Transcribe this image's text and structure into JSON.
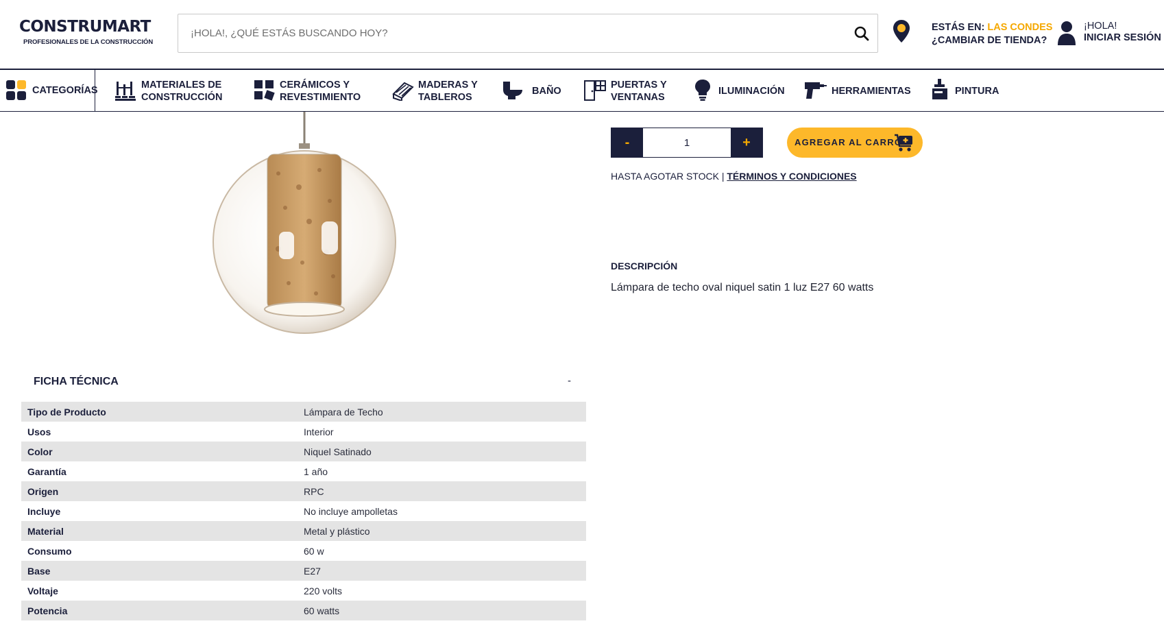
{
  "header": {
    "logo_word": "CONSTRUMART",
    "logo_tagline": "PROFESIONALES DE LA CONSTRUCCIÓN",
    "search_placeholder": "¡HOLA!, ¿QUÉ ESTÁS BUSCANDO HOY?",
    "search_value": "",
    "store_prefix": "ESTÁS EN: ",
    "store_name": "LAS CONDES",
    "change_store": "¿CAMBIAR DE TIENDA?",
    "greeting": "¡HOLA!",
    "login": "INICIAR SESIÓN"
  },
  "nav": {
    "categories": "CATEGORÍAS",
    "items": [
      {
        "line1": "MATERIALES DE",
        "line2": "CONSTRUCCIÓN",
        "icon": "bricks-icon"
      },
      {
        "line1": "CERÁMICOS Y",
        "line2": "REVESTIMIENTO",
        "icon": "tiles-icon"
      },
      {
        "line1": "MADERAS Y",
        "line2": "TABLEROS",
        "icon": "wood-icon"
      },
      {
        "line1": "BAÑO",
        "line2": "",
        "icon": "toilet-icon"
      },
      {
        "line1": "PUERTAS Y",
        "line2": "VENTANAS",
        "icon": "door-icon"
      },
      {
        "line1": "ILUMINACIÓN",
        "line2": "",
        "icon": "bulb-icon"
      },
      {
        "line1": "HERRAMIENTAS",
        "line2": "",
        "icon": "drill-icon"
      },
      {
        "line1": "PINTURA",
        "line2": "",
        "icon": "paint-icon"
      }
    ]
  },
  "purchase": {
    "minus": "-",
    "plus": "+",
    "quantity": "1",
    "add_to_cart": "AGREGAR AL CARRO",
    "stock_note": "HASTA AGOTAR STOCK | ",
    "terms": "TÉRMINOS Y CONDICIONES"
  },
  "description": {
    "title": "DESCRIPCIÓN",
    "text": "Lámpara de techo oval niquel satin 1 luz E27 60 watts"
  },
  "specs": {
    "title": "FICHA TÉCNICA",
    "toggle": "-",
    "rows": [
      {
        "key": "Tipo de Producto",
        "value": "Lámpara de Techo"
      },
      {
        "key": "Usos",
        "value": "Interior"
      },
      {
        "key": "Color",
        "value": "Niquel Satinado"
      },
      {
        "key": "Garantía",
        "value": "1 año"
      },
      {
        "key": "Origen",
        "value": "RPC"
      },
      {
        "key": "Incluye",
        "value": "No incluye ampolletas"
      },
      {
        "key": "Material",
        "value": "Metal y plástico"
      },
      {
        "key": "Consumo",
        "value": "60 w"
      },
      {
        "key": "Base",
        "value": "E27"
      },
      {
        "key": "Voltaje",
        "value": "220 volts"
      },
      {
        "key": "Potencia",
        "value": "60 watts"
      }
    ]
  },
  "colors": {
    "brand_navy": "#1b1f3b",
    "brand_yellow": "#fdb82a",
    "store_orange": "#f5a800",
    "row_shade": "#e4e4e4"
  }
}
